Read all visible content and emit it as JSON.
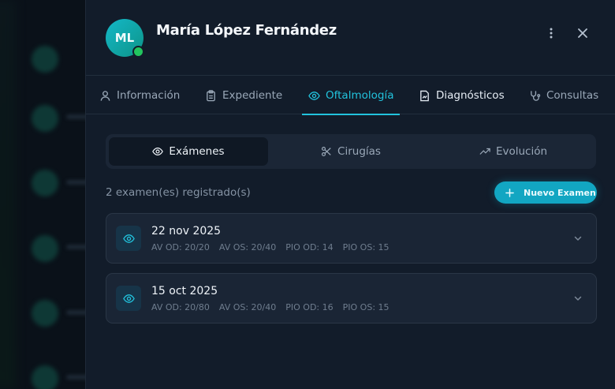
{
  "patient": {
    "initials": "ML",
    "name": "María López Fernández"
  },
  "tabs": [
    {
      "label": "Información",
      "icon": "user-icon"
    },
    {
      "label": "Expediente",
      "icon": "clipboard-icon"
    },
    {
      "label": "Oftalmología",
      "icon": "eye-icon",
      "active": true
    },
    {
      "label": "Diagnósticos",
      "icon": "file-chart-icon"
    },
    {
      "label": "Consultas",
      "icon": "stethoscope-icon"
    }
  ],
  "subtabs": [
    {
      "label": "Exámenes",
      "icon": "eye-icon",
      "active": true
    },
    {
      "label": "Cirugías",
      "icon": "scissors-icon"
    },
    {
      "label": "Evolución",
      "icon": "trending-up-icon"
    }
  ],
  "exam_count_text": "2 examen(es) registrado(s)",
  "new_exam_label": "Nuevo Examen",
  "exams": [
    {
      "date": "22 nov 2025",
      "av_od": "AV OD: 20/20",
      "av_os": "AV OS: 20/40",
      "pio_od": "PIO OD: 14",
      "pio_os": "PIO OS: 15"
    },
    {
      "date": "15 oct 2025",
      "av_od": "AV OD: 20/80",
      "av_os": "AV OS: 20/40",
      "pio_od": "PIO OD: 16",
      "pio_os": "PIO OS: 15"
    }
  ],
  "colors": {
    "accent": "#22c3dd",
    "button": "#12a6c2",
    "online": "#22c55e",
    "panel": "#121c2a"
  }
}
